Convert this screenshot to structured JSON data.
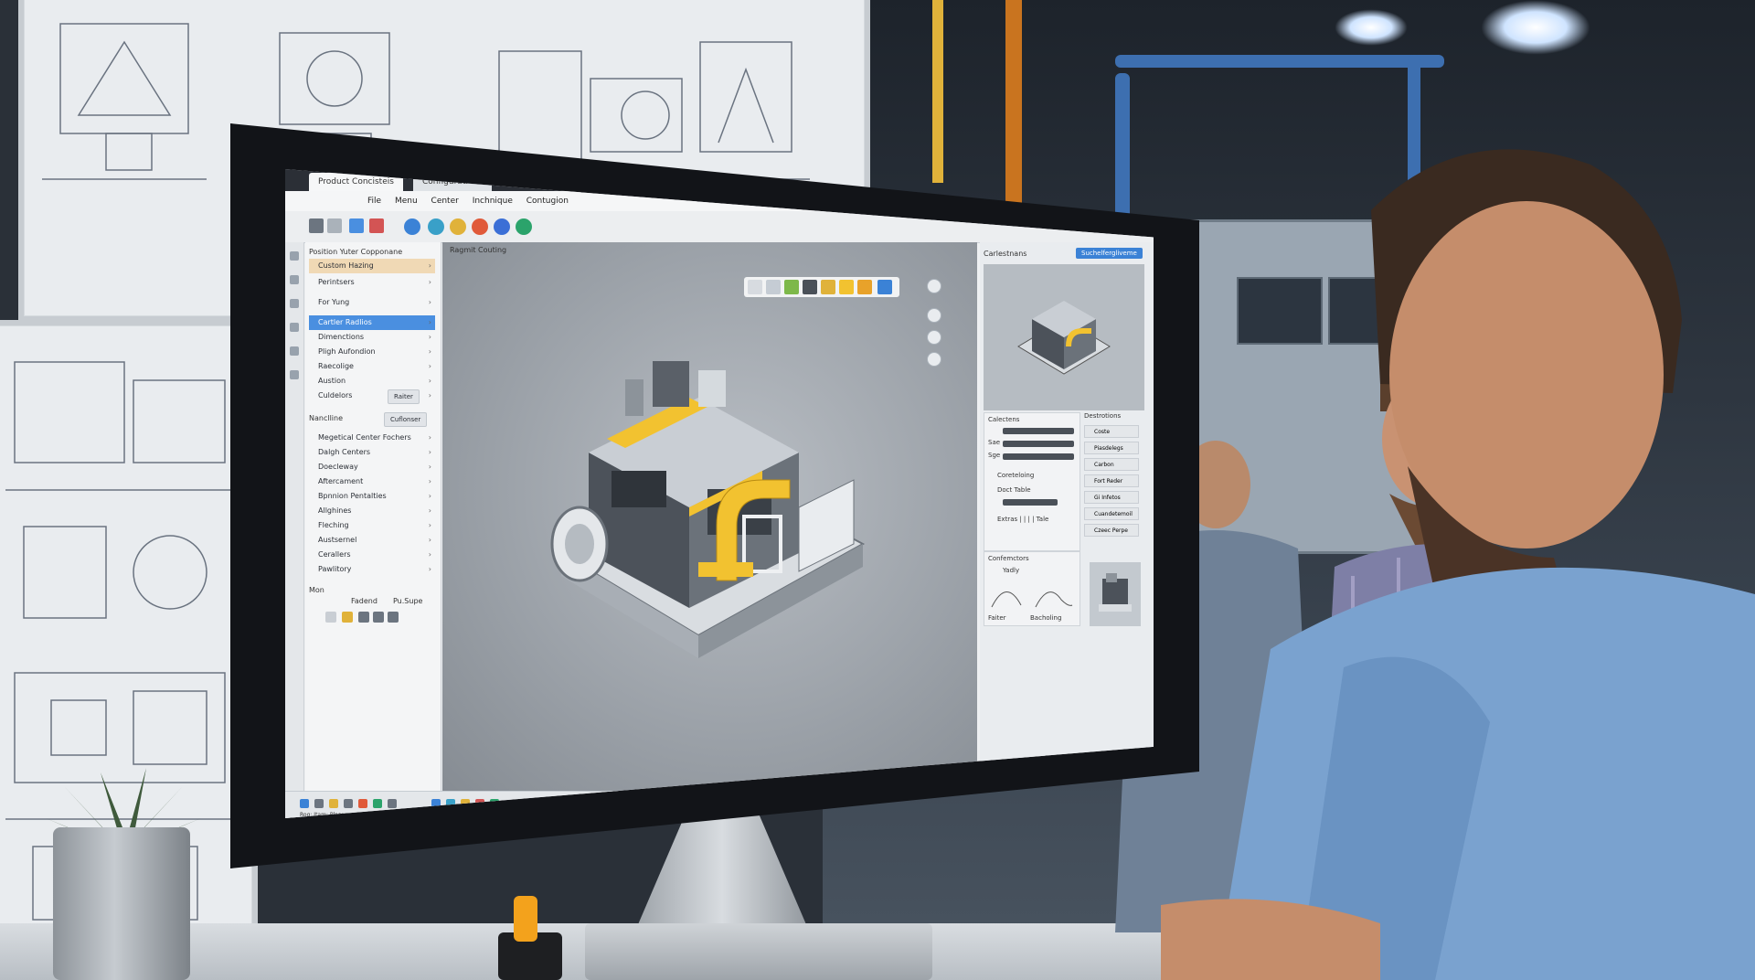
{
  "window": {
    "tabs": [
      "Product Concisteis",
      "Configurations"
    ]
  },
  "menu": [
    "File",
    "Menu",
    "Center",
    "Inchnique",
    "Contugion"
  ],
  "sidebar": {
    "header": "Position Yuter Copponane",
    "top_items": [
      {
        "label": "Custom Hazing",
        "state": "highlight"
      },
      {
        "label": "Perintsers"
      },
      {
        "label": "For Yung"
      },
      {
        "label": "Cartler Radlios",
        "state": "selected"
      },
      {
        "label": "Dimenctions"
      },
      {
        "label": "Pligh Aufondion"
      },
      {
        "label": "Raecolige"
      },
      {
        "label": "Austion"
      },
      {
        "label": "Culdelors"
      }
    ],
    "culdelors_button": "Raiter",
    "section2_header": "Nanclline",
    "section2_button": "Cuflonser",
    "section2_items": [
      "Megetical Center Fochers",
      "Dalgh Centers",
      "Doecleway",
      "Aftercament",
      "Bpnnion Pentalties",
      "Allghines",
      "Fleching",
      "Austsernel",
      "Cerallers",
      "Pawlitory"
    ],
    "section3_header": "Mon",
    "section3_cols": [
      "Fadend",
      "Pu.Supe"
    ]
  },
  "viewport": {
    "label": "Ragmit Couting"
  },
  "right_panel": {
    "header": "Carlestnans",
    "action_button": "Suchelfergliveme",
    "props_header": "Calectens",
    "prop_labels": [
      "Sae",
      "Sge"
    ],
    "controls_header": "Coreteloing",
    "doc_label": "Doct Table",
    "extra_label": "Extras | | | | Tale",
    "list_header": "Destrotions",
    "list_items": [
      "Coste",
      "Piasdelegs",
      "Carbon",
      "Fort Reder",
      "Gi Infetos",
      "Cuandetemoil",
      "Czeec Perpe"
    ],
    "conf_header": "Confemctors",
    "conf_item": "Yadly",
    "footer_left": "Faiter",
    "footer_right": "Bacholing"
  },
  "statusbar": {
    "text": "Rog: Itam: Plaser"
  },
  "colors": {
    "accent_blue": "#4a8fe0",
    "highlight": "#f0d9b5",
    "yellow_parts": "#f2c230"
  }
}
